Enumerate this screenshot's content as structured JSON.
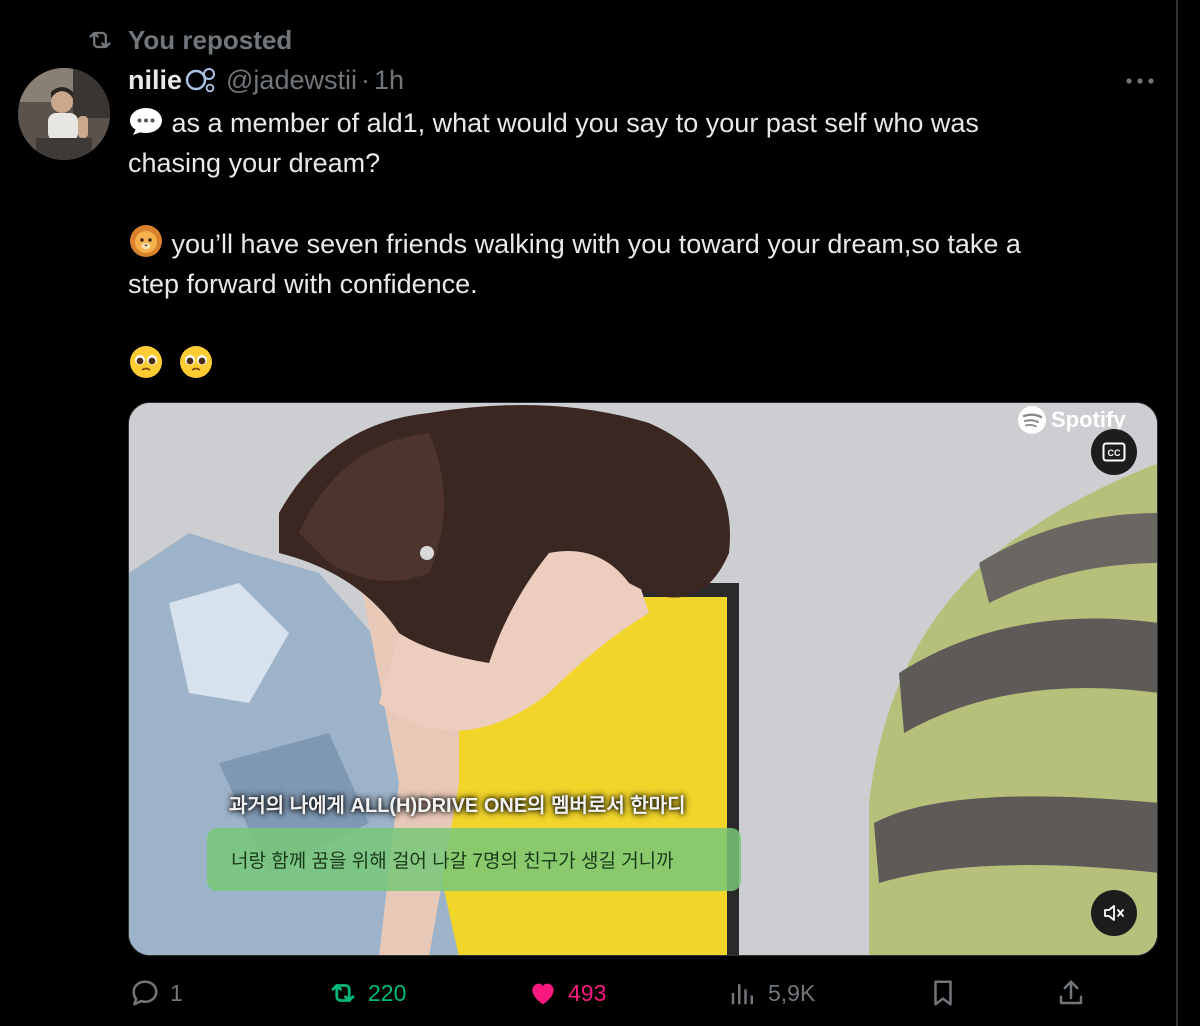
{
  "repost_banner": {
    "label": "You reposted"
  },
  "tweet": {
    "display_name": "nilie",
    "handle": "@jadewstii",
    "separator": "·",
    "time": "1h",
    "lines": [
      "as a member of ald1, what would you say to your past self who was",
      "chasing your dream?",
      "you’ll have seven friends walking with you toward your dream,so take a",
      "step forward with confidence."
    ],
    "emoji_line_count": 2
  },
  "media": {
    "brand": "Spotify",
    "cc_label": "CC",
    "caption_title": "과거의 나에게 ALL(H)DRIVE ONE의 멤버로서 한마디",
    "caption_body": "너랑 함께 꿈을 위해 걸어 나갈 7명의 친구가 생길 거니까"
  },
  "actions": {
    "replies": "1",
    "reposts": "220",
    "likes": "493",
    "views": "5,9K"
  },
  "colors": {
    "background": "#000000",
    "text": "#e7e9ea",
    "muted": "#71767b",
    "repost_active": "#00ba7c",
    "like_active": "#f91880"
  }
}
